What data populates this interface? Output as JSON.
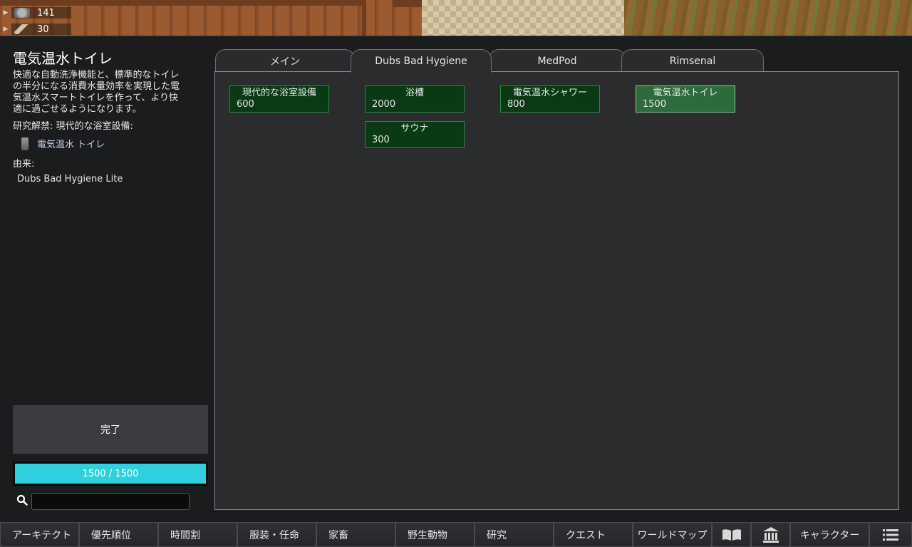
{
  "resources": [
    {
      "icon": "stone-chunk-icon",
      "value": "141"
    },
    {
      "icon": "wood-plank-icon",
      "value": "30"
    }
  ],
  "project": {
    "title": "電気温水トイレ",
    "description": "快適な自動洗浄機能と、標準的なトイレ\nの半分になる消費水量効率を実現した電\n気温水スマートトイレを作って、より快\n適に過ごせるようになります。",
    "unlocks_label": "研究解禁: 現代的な浴室設備:",
    "unlock_item": "電気温水 トイレ",
    "source_label": "由来:",
    "source_name": "Dubs Bad Hygiene Lite",
    "status": "完了",
    "progress_text": "1500 / 1500",
    "progress_fraction": 1.0
  },
  "search": {
    "value": "",
    "placeholder": ""
  },
  "tabs": [
    {
      "label": "メイン"
    },
    {
      "label": "Dubs Bad Hygiene"
    },
    {
      "label": "MedPod"
    },
    {
      "label": "Rimsenal"
    }
  ],
  "active_tab": "Dubs Bad Hygiene",
  "nodes": {
    "modern": {
      "label": "現代的な浴室設備",
      "cost": "600"
    },
    "bath": {
      "label": "浴槽",
      "cost": "2000"
    },
    "sauna": {
      "label": "サウナ",
      "cost": "300"
    },
    "shower": {
      "label": "電気温水シャワー",
      "cost": "800"
    },
    "toilet": {
      "label": "電気温水トイレ",
      "cost": "1500"
    }
  },
  "bottom_bar": [
    {
      "label": "アーキテクト"
    },
    {
      "label": "優先順位"
    },
    {
      "label": "時間割"
    },
    {
      "label": "服装・任命"
    },
    {
      "label": "家畜"
    },
    {
      "label": "野生動物"
    },
    {
      "label": "研究"
    },
    {
      "label": "クエスト"
    },
    {
      "label": "ワールドマップ"
    },
    {
      "icon": "book-icon"
    },
    {
      "icon": "history-building-icon"
    },
    {
      "label": "キャラクター"
    },
    {
      "icon": "menu-list-icon"
    }
  ],
  "colors": {
    "node_fill": "#0a3a14",
    "node_border": "#2d8a3e",
    "node_selected": "#2e6b3c",
    "progress_fill": "#2fd0dc"
  }
}
